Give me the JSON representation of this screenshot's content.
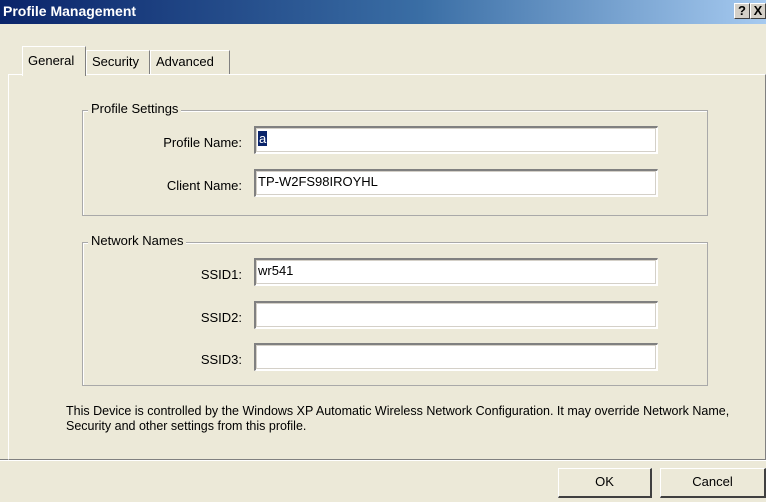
{
  "window": {
    "title": "Profile Management",
    "help_button": "?",
    "close_button": "X"
  },
  "tabs": [
    {
      "label": "General",
      "active": true
    },
    {
      "label": "Security",
      "active": false
    },
    {
      "label": "Advanced",
      "active": false
    }
  ],
  "profile_settings": {
    "legend": "Profile Settings",
    "profile_name_label": "Profile Name:",
    "profile_name_value": "a",
    "client_name_label": "Client Name:",
    "client_name_value": "TP-W2FS98IROYHL"
  },
  "network_names": {
    "legend": "Network Names",
    "ssid1_label": "SSID1:",
    "ssid1_value": "wr541",
    "ssid2_label": "SSID2:",
    "ssid2_value": "",
    "ssid3_label": "SSID3:",
    "ssid3_value": ""
  },
  "notice": "This Device is controlled by the Windows XP Automatic Wireless Network Configuration. It may override Network Name, Security and other settings from this profile.",
  "buttons": {
    "ok": "OK",
    "cancel": "Cancel"
  }
}
